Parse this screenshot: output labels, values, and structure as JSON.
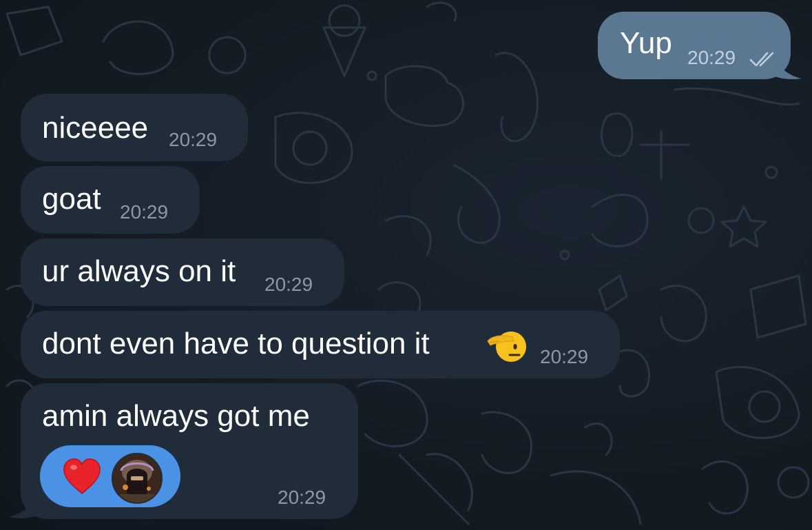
{
  "chat": {
    "messages": [
      {
        "id": "m1",
        "direction": "outgoing",
        "text": "Yup",
        "time": "20:29",
        "status_icon": "double-check-icon"
      },
      {
        "id": "m2",
        "direction": "incoming",
        "text": "niceeee",
        "time": "20:29"
      },
      {
        "id": "m3",
        "direction": "incoming",
        "text": "goat",
        "time": "20:29"
      },
      {
        "id": "m4",
        "direction": "incoming",
        "text": "ur always on it",
        "time": "20:29"
      },
      {
        "id": "m5",
        "direction": "incoming",
        "text": "dont even have to question it",
        "emoji": "saluting-face-icon",
        "time": "20:29"
      },
      {
        "id": "m6",
        "direction": "incoming",
        "text": "amin always got me",
        "time": "20:29",
        "reaction": {
          "emoji": "red-heart-icon",
          "reactor": "reactor-avatar"
        }
      }
    ]
  },
  "colors": {
    "background": "#131a22",
    "incoming_bubble": "#212c3a",
    "outgoing_bubble": "#5b7893",
    "reaction_pill": "#4b92e6",
    "heart": "#e8232b",
    "timestamp": "#8b98a6"
  }
}
